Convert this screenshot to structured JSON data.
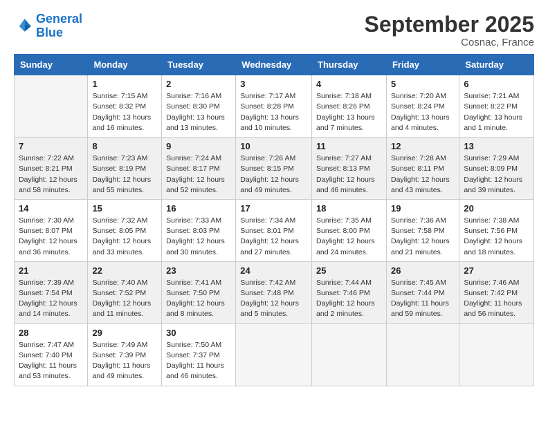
{
  "logo": {
    "line1": "General",
    "line2": "Blue"
  },
  "title": "September 2025",
  "subtitle": "Cosnac, France",
  "days_of_week": [
    "Sunday",
    "Monday",
    "Tuesday",
    "Wednesday",
    "Thursday",
    "Friday",
    "Saturday"
  ],
  "weeks": [
    [
      {
        "day": "",
        "sunrise": "",
        "sunset": "",
        "daylight": ""
      },
      {
        "day": "1",
        "sunrise": "Sunrise: 7:15 AM",
        "sunset": "Sunset: 8:32 PM",
        "daylight": "Daylight: 13 hours and 16 minutes."
      },
      {
        "day": "2",
        "sunrise": "Sunrise: 7:16 AM",
        "sunset": "Sunset: 8:30 PM",
        "daylight": "Daylight: 13 hours and 13 minutes."
      },
      {
        "day": "3",
        "sunrise": "Sunrise: 7:17 AM",
        "sunset": "Sunset: 8:28 PM",
        "daylight": "Daylight: 13 hours and 10 minutes."
      },
      {
        "day": "4",
        "sunrise": "Sunrise: 7:18 AM",
        "sunset": "Sunset: 8:26 PM",
        "daylight": "Daylight: 13 hours and 7 minutes."
      },
      {
        "day": "5",
        "sunrise": "Sunrise: 7:20 AM",
        "sunset": "Sunset: 8:24 PM",
        "daylight": "Daylight: 13 hours and 4 minutes."
      },
      {
        "day": "6",
        "sunrise": "Sunrise: 7:21 AM",
        "sunset": "Sunset: 8:22 PM",
        "daylight": "Daylight: 13 hours and 1 minute."
      }
    ],
    [
      {
        "day": "7",
        "sunrise": "Sunrise: 7:22 AM",
        "sunset": "Sunset: 8:21 PM",
        "daylight": "Daylight: 12 hours and 58 minutes."
      },
      {
        "day": "8",
        "sunrise": "Sunrise: 7:23 AM",
        "sunset": "Sunset: 8:19 PM",
        "daylight": "Daylight: 12 hours and 55 minutes."
      },
      {
        "day": "9",
        "sunrise": "Sunrise: 7:24 AM",
        "sunset": "Sunset: 8:17 PM",
        "daylight": "Daylight: 12 hours and 52 minutes."
      },
      {
        "day": "10",
        "sunrise": "Sunrise: 7:26 AM",
        "sunset": "Sunset: 8:15 PM",
        "daylight": "Daylight: 12 hours and 49 minutes."
      },
      {
        "day": "11",
        "sunrise": "Sunrise: 7:27 AM",
        "sunset": "Sunset: 8:13 PM",
        "daylight": "Daylight: 12 hours and 46 minutes."
      },
      {
        "day": "12",
        "sunrise": "Sunrise: 7:28 AM",
        "sunset": "Sunset: 8:11 PM",
        "daylight": "Daylight: 12 hours and 43 minutes."
      },
      {
        "day": "13",
        "sunrise": "Sunrise: 7:29 AM",
        "sunset": "Sunset: 8:09 PM",
        "daylight": "Daylight: 12 hours and 39 minutes."
      }
    ],
    [
      {
        "day": "14",
        "sunrise": "Sunrise: 7:30 AM",
        "sunset": "Sunset: 8:07 PM",
        "daylight": "Daylight: 12 hours and 36 minutes."
      },
      {
        "day": "15",
        "sunrise": "Sunrise: 7:32 AM",
        "sunset": "Sunset: 8:05 PM",
        "daylight": "Daylight: 12 hours and 33 minutes."
      },
      {
        "day": "16",
        "sunrise": "Sunrise: 7:33 AM",
        "sunset": "Sunset: 8:03 PM",
        "daylight": "Daylight: 12 hours and 30 minutes."
      },
      {
        "day": "17",
        "sunrise": "Sunrise: 7:34 AM",
        "sunset": "Sunset: 8:01 PM",
        "daylight": "Daylight: 12 hours and 27 minutes."
      },
      {
        "day": "18",
        "sunrise": "Sunrise: 7:35 AM",
        "sunset": "Sunset: 8:00 PM",
        "daylight": "Daylight: 12 hours and 24 minutes."
      },
      {
        "day": "19",
        "sunrise": "Sunrise: 7:36 AM",
        "sunset": "Sunset: 7:58 PM",
        "daylight": "Daylight: 12 hours and 21 minutes."
      },
      {
        "day": "20",
        "sunrise": "Sunrise: 7:38 AM",
        "sunset": "Sunset: 7:56 PM",
        "daylight": "Daylight: 12 hours and 18 minutes."
      }
    ],
    [
      {
        "day": "21",
        "sunrise": "Sunrise: 7:39 AM",
        "sunset": "Sunset: 7:54 PM",
        "daylight": "Daylight: 12 hours and 14 minutes."
      },
      {
        "day": "22",
        "sunrise": "Sunrise: 7:40 AM",
        "sunset": "Sunset: 7:52 PM",
        "daylight": "Daylight: 12 hours and 11 minutes."
      },
      {
        "day": "23",
        "sunrise": "Sunrise: 7:41 AM",
        "sunset": "Sunset: 7:50 PM",
        "daylight": "Daylight: 12 hours and 8 minutes."
      },
      {
        "day": "24",
        "sunrise": "Sunrise: 7:42 AM",
        "sunset": "Sunset: 7:48 PM",
        "daylight": "Daylight: 12 hours and 5 minutes."
      },
      {
        "day": "25",
        "sunrise": "Sunrise: 7:44 AM",
        "sunset": "Sunset: 7:46 PM",
        "daylight": "Daylight: 12 hours and 2 minutes."
      },
      {
        "day": "26",
        "sunrise": "Sunrise: 7:45 AM",
        "sunset": "Sunset: 7:44 PM",
        "daylight": "Daylight: 11 hours and 59 minutes."
      },
      {
        "day": "27",
        "sunrise": "Sunrise: 7:46 AM",
        "sunset": "Sunset: 7:42 PM",
        "daylight": "Daylight: 11 hours and 56 minutes."
      }
    ],
    [
      {
        "day": "28",
        "sunrise": "Sunrise: 7:47 AM",
        "sunset": "Sunset: 7:40 PM",
        "daylight": "Daylight: 11 hours and 53 minutes."
      },
      {
        "day": "29",
        "sunrise": "Sunrise: 7:49 AM",
        "sunset": "Sunset: 7:39 PM",
        "daylight": "Daylight: 11 hours and 49 minutes."
      },
      {
        "day": "30",
        "sunrise": "Sunrise: 7:50 AM",
        "sunset": "Sunset: 7:37 PM",
        "daylight": "Daylight: 11 hours and 46 minutes."
      },
      {
        "day": "",
        "sunrise": "",
        "sunset": "",
        "daylight": ""
      },
      {
        "day": "",
        "sunrise": "",
        "sunset": "",
        "daylight": ""
      },
      {
        "day": "",
        "sunrise": "",
        "sunset": "",
        "daylight": ""
      },
      {
        "day": "",
        "sunrise": "",
        "sunset": "",
        "daylight": ""
      }
    ]
  ]
}
